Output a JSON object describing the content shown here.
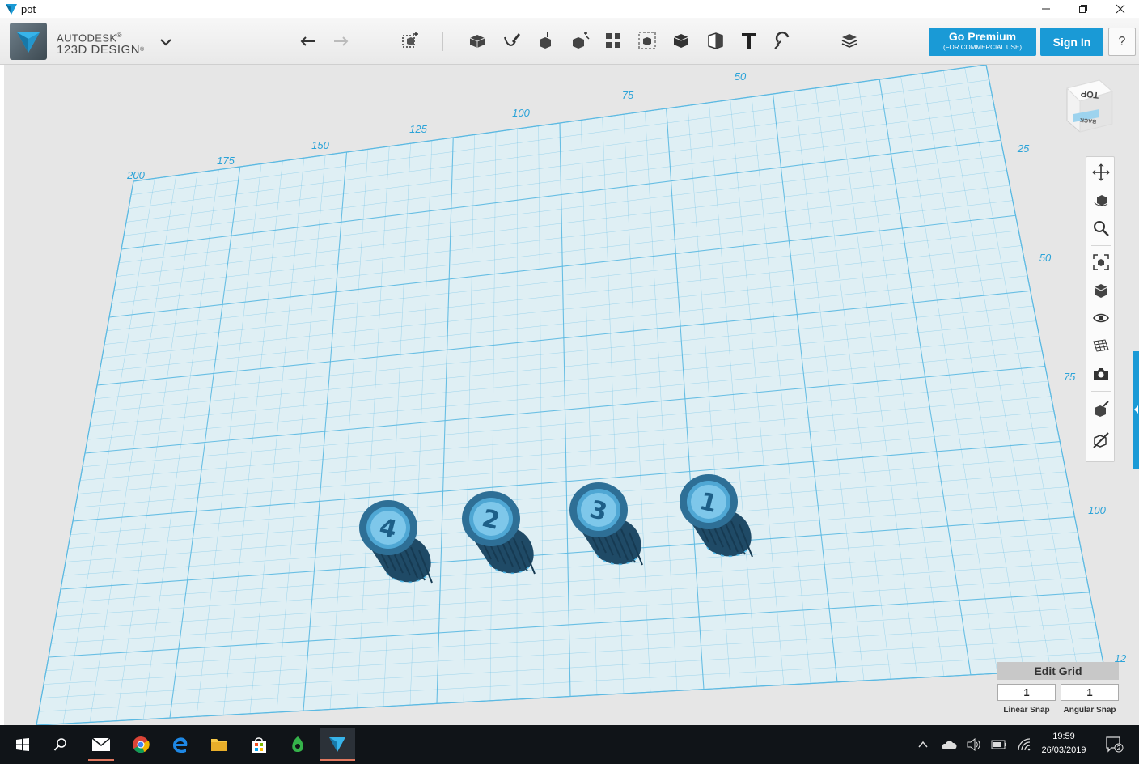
{
  "window": {
    "title": "pot"
  },
  "brand": {
    "line1": "AUTODESK",
    "line2": "123D DESIGN",
    "line1_sup": "®",
    "line2_sup": "®"
  },
  "toolbar": {
    "icons": [
      "undo-icon",
      "redo-icon",
      "new-primitive-icon",
      "primitives-icon",
      "sketch-icon",
      "construct-icon",
      "modify-icon",
      "pattern-icon",
      "grouping-icon",
      "combine-icon",
      "measure-icon",
      "text-icon",
      "snap-icon",
      "material-icon"
    ]
  },
  "premium": {
    "label": "Go Premium",
    "sublabel": "(FOR COMMERCIAL USE)"
  },
  "signin": {
    "label": "Sign In"
  },
  "help": {
    "label": "?"
  },
  "viewcube": {
    "top": "TOP",
    "back": "BACK"
  },
  "grid_axis": {
    "top": [
      "200",
      "175",
      "150",
      "125",
      "100",
      "75",
      "50"
    ],
    "right": [
      "25",
      "50",
      "75",
      "100",
      "12"
    ]
  },
  "knobs": {
    "labels": [
      "4",
      "2",
      "3",
      "1"
    ]
  },
  "colors": {
    "accent": "#1a9ad6",
    "grid": "#5bb9e2",
    "model": "#3e8fbf"
  },
  "edit_grid": {
    "title": "Edit Grid",
    "linear_value": "1",
    "angular_value": "1",
    "linear_label": "Linear Snap",
    "angular_label": "Angular Snap"
  },
  "taskbar": {
    "time": "19:59",
    "date": "26/03/2019",
    "notification_count": "2"
  }
}
